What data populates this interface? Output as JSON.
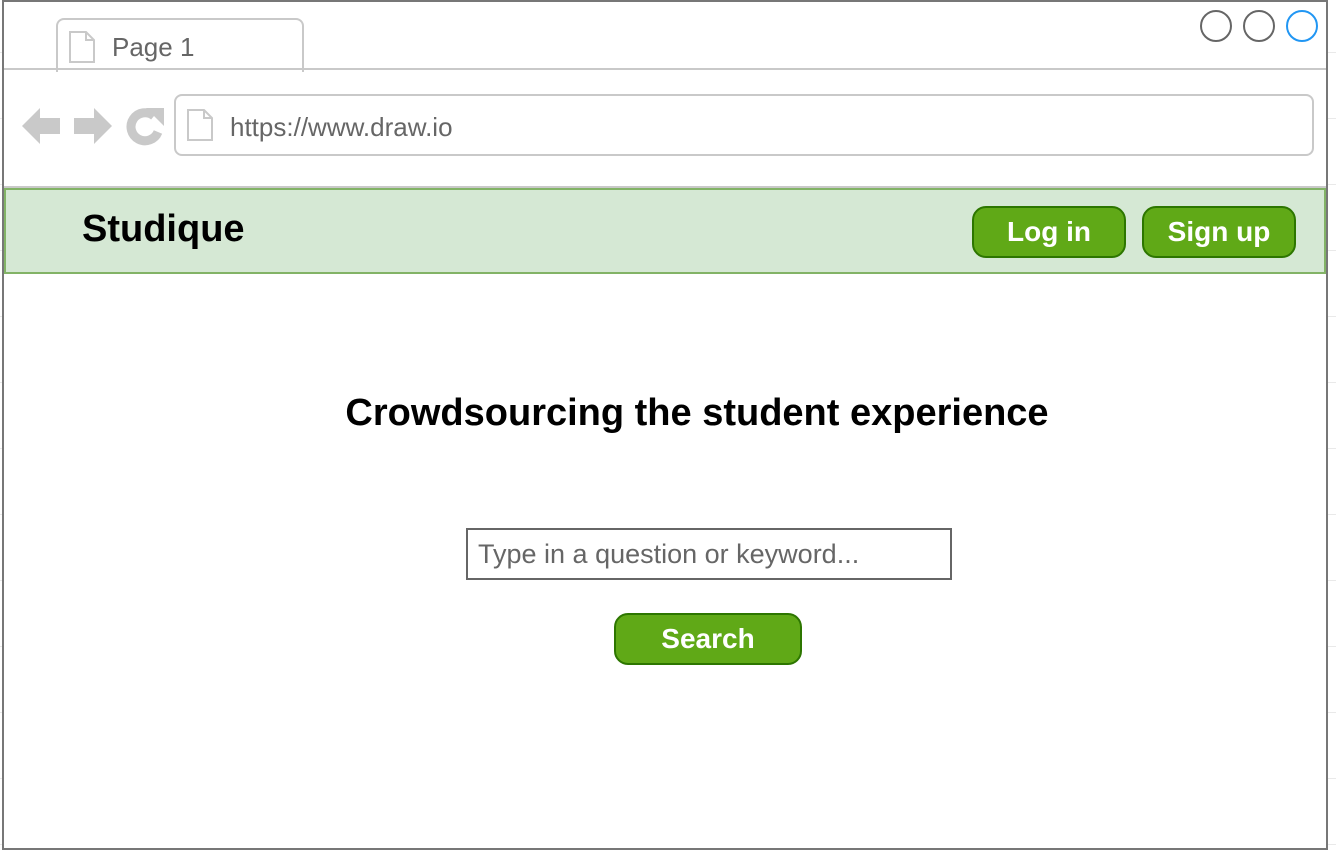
{
  "browser": {
    "tab_label": "Page 1",
    "url": "https://www.draw.io"
  },
  "header": {
    "brand": "Studique",
    "login_label": "Log in",
    "signup_label": "Sign up"
  },
  "main": {
    "headline": "Crowdsourcing the student experience",
    "search_placeholder": "Type in a question or keyword...",
    "search_value": "",
    "search_button_label": "Search"
  },
  "colors": {
    "accent": "#60a917",
    "accent_border": "#2d7600",
    "header_bg": "#d5e8d4",
    "header_border": "#82b366",
    "active_window_circle": "#2196f3"
  },
  "icons": [
    "page-icon",
    "back-arrow-icon",
    "forward-arrow-icon",
    "refresh-icon"
  ]
}
